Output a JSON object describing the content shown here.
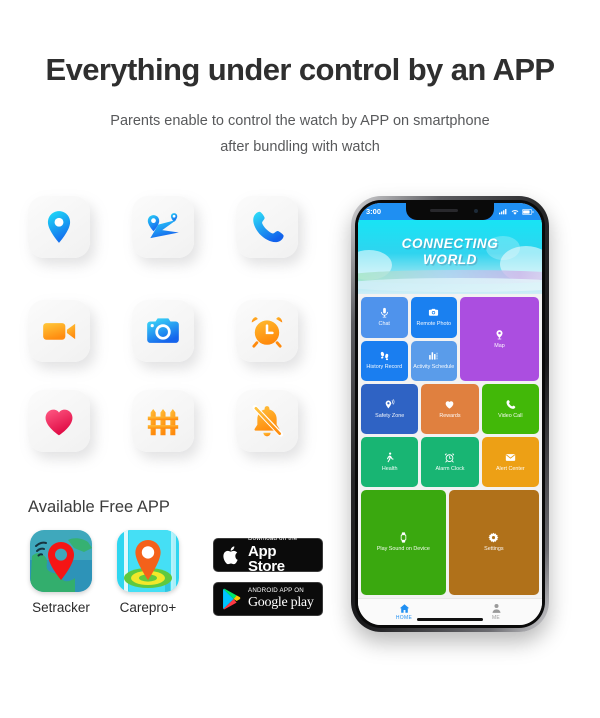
{
  "header": {
    "headline": "Everything under control by an APP",
    "sub_line1": "Parents enable to control the watch by APP on smartphone",
    "sub_line2": "after bundling with watch"
  },
  "features": {
    "icons": [
      {
        "name": "location-pin-icon",
        "label": "Location",
        "color": "#19c9f5"
      },
      {
        "name": "route-tracking-icon",
        "label": "Route Tracking",
        "color": "#1f9ef0"
      },
      {
        "name": "phone-call-icon",
        "label": "Phone Call",
        "color": "#1fc9f5"
      },
      {
        "name": "video-camera-icon",
        "label": "Video Camera",
        "color": "#ffb020"
      },
      {
        "name": "camera-icon",
        "label": "Camera",
        "color": "#2fb8f5"
      },
      {
        "name": "alarm-clock-icon",
        "label": "Alarm Clock",
        "color": "#ff9c12"
      },
      {
        "name": "heart-icon",
        "label": "Heart Rate",
        "color": "#f0325c"
      },
      {
        "name": "fence-safety-zone-icon",
        "label": "Safety Fence",
        "color": "#ff9c12"
      },
      {
        "name": "bell-muted-icon",
        "label": "Silent Mode",
        "color": "#ffa41c"
      }
    ]
  },
  "available_apps": {
    "label": "Available Free APP",
    "apps": [
      {
        "name": "Setracker"
      },
      {
        "name": "Carepro+"
      }
    ]
  },
  "store_badges": [
    {
      "id": "app-store",
      "top": "Download on the",
      "bottom": "App Store"
    },
    {
      "id": "google-play",
      "top": "ANDROID APP ON",
      "bottom": "Google play"
    }
  ],
  "phone": {
    "statusbar": {
      "time": "3:00"
    },
    "banner": {
      "line1": "CONNECTING",
      "line2": "WORLD"
    },
    "tiles": [
      {
        "label": "Chat",
        "icon": "microphone-icon",
        "color": "#4f93ec"
      },
      {
        "label": "Remote Photo",
        "icon": "camera-icon",
        "color": "#1a80f0"
      },
      {
        "label": "History Record",
        "icon": "footsteps-icon",
        "color": "#1a7ef0"
      },
      {
        "label": "Activity Schedule",
        "icon": "chart-bars-icon",
        "color": "#5a9cea"
      },
      {
        "label": "Map",
        "icon": "map-pin-icon",
        "color": "#ab4ee0"
      },
      {
        "label": "Safety Zone",
        "icon": "geofence-pin-icon",
        "color": "#2f63c4"
      },
      {
        "label": "Rewards",
        "icon": "heart-icon",
        "color": "#e0803f"
      },
      {
        "label": "Video Call",
        "icon": "phone-icon",
        "color": "#42b808"
      },
      {
        "label": "Health",
        "icon": "walking-person-icon",
        "color": "#18b573"
      },
      {
        "label": "Alarm Clock",
        "icon": "alarm-clock-icon",
        "color": "#18b573"
      },
      {
        "label": "Alert Center",
        "icon": "envelope-icon",
        "color": "#eda015"
      },
      {
        "label": "Play Sound on Device",
        "icon": "watch-icon",
        "color": "#3aa80f"
      },
      {
        "label": "Settings",
        "icon": "gear-icon",
        "color": "#b0711a"
      }
    ],
    "navbar": [
      {
        "label": "HOME",
        "icon": "home-icon",
        "active": true
      },
      {
        "label": "ME",
        "icon": "person-icon",
        "active": false
      }
    ]
  },
  "colors": {
    "headline": "#2f2f2f",
    "accent_blue": "#1f8ff2",
    "banner_cyan": "#18e4f5",
    "map_purple": "#ab4ee0"
  }
}
